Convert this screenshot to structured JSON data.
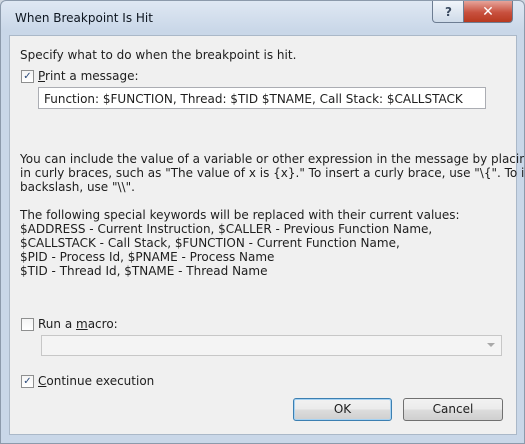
{
  "window": {
    "title": "When Breakpoint Is Hit",
    "help_glyph": "?",
    "close_glyph": "✕"
  },
  "intro": "Specify what to do when the breakpoint is hit.",
  "print_message": {
    "checked": true,
    "check_glyph": "✓",
    "label_mnemonic": "P",
    "label_rest": "rint a message:",
    "value": "Function: $FUNCTION, Thread: $TID $TNAME, Call Stack: $CALLSTACK"
  },
  "info_lines": [
    "You can include the value of a variable or other expression in the message by placing it",
    "in curly braces, such as \"The value of x is {x}.\" To insert a curly brace, use \"\\{\". To insert a",
    "backslash, use \"\\\\\"."
  ],
  "keywords_lines": [
    "The following special keywords will be replaced with their current values:",
    "$ADDRESS - Current Instruction, $CALLER - Previous Function Name,",
    "$CALLSTACK - Call Stack, $FUNCTION - Current Function Name,",
    "$PID - Process Id, $PNAME - Process Name",
    "$TID - Thread Id, $TNAME - Thread Name"
  ],
  "run_macro": {
    "checked": false,
    "label_prefix": "Run a ",
    "label_mnemonic": "m",
    "label_rest": "acro:",
    "value": ""
  },
  "continue_execution": {
    "checked": true,
    "check_glyph": "✓",
    "label_mnemonic": "C",
    "label_rest": "ontinue execution"
  },
  "buttons": {
    "ok": "OK",
    "cancel": "Cancel"
  }
}
